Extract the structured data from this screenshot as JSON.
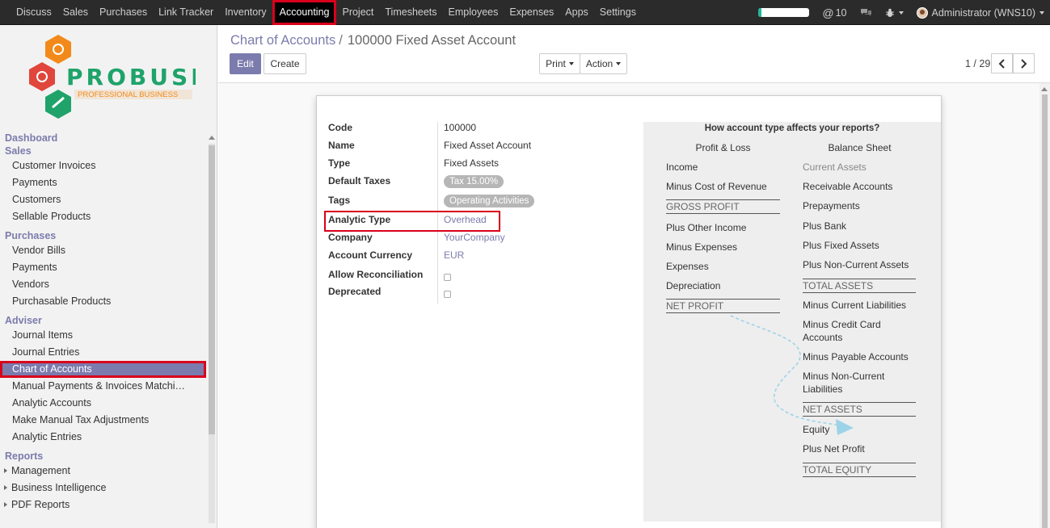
{
  "topbar": {
    "menu": [
      "Discuss",
      "Sales",
      "Purchases",
      "Link Tracker",
      "Inventory",
      "Accounting",
      "Project",
      "Timesheets",
      "Employees",
      "Expenses",
      "Apps",
      "Settings"
    ],
    "active_menu": "Accounting",
    "progress_fraction": 0.06,
    "activity_count": "10",
    "user": "Administrator (WNS10)"
  },
  "logo": {
    "name": "PROBUSE",
    "tagline": "PROFESSIONAL BUSINESS"
  },
  "sidebar": {
    "sections": [
      {
        "title": "Dashboard",
        "items": []
      },
      {
        "title": "Sales",
        "items": [
          "Customer Invoices",
          "Payments",
          "Customers",
          "Sellable Products"
        ]
      },
      {
        "title": "Purchases",
        "items": [
          "Vendor Bills",
          "Payments",
          "Vendors",
          "Purchasable Products"
        ]
      },
      {
        "title": "Adviser",
        "items": [
          "Journal Items",
          "Journal Entries",
          "Chart of Accounts",
          "Manual Payments & Invoices Matchi…",
          "Analytic Accounts",
          "Make Manual Tax Adjustments",
          "Analytic Entries"
        ]
      },
      {
        "title": "Reports",
        "items": [
          "Management",
          "Business Intelligence",
          "PDF Reports"
        ]
      }
    ],
    "active_item": "Chart of Accounts"
  },
  "control": {
    "breadcrumb_parent": "Chart of Accounts",
    "breadcrumb_sep": "/",
    "breadcrumb_current": "100000 Fixed Asset Account",
    "edit_label": "Edit",
    "create_label": "Create",
    "print_label": "Print",
    "action_label": "Action",
    "pager": "1 / 29"
  },
  "form": {
    "fields": [
      {
        "label": "Code",
        "value": "100000",
        "kind": "text"
      },
      {
        "label": "Name",
        "value": "Fixed Asset Account",
        "kind": "text"
      },
      {
        "label": "Type",
        "value": "Fixed Assets",
        "kind": "text"
      },
      {
        "label": "Default Taxes",
        "value": "Tax 15.00%",
        "kind": "badge"
      },
      {
        "label": "Tags",
        "value": "Operating Activities",
        "kind": "badge"
      },
      {
        "label": "Analytic Type",
        "value": "Overhead",
        "kind": "link"
      },
      {
        "label": "Company",
        "value": "YourCompany",
        "kind": "link"
      },
      {
        "label": "Account Currency",
        "value": "EUR",
        "kind": "link"
      },
      {
        "label": "Allow Reconciliation",
        "value": false,
        "kind": "checkbox"
      },
      {
        "label": "Deprecated",
        "value": false,
        "kind": "checkbox"
      }
    ]
  },
  "info": {
    "title": "How account type affects your reports?",
    "pl_header": "Profit & Loss",
    "bs_header": "Balance Sheet",
    "pl": [
      {
        "text": "Income",
        "style": "normal"
      },
      {
        "text": "Minus Cost of Revenue",
        "style": "normal"
      },
      {
        "text": "GROSS PROFIT",
        "style": "total"
      },
      {
        "text": "Plus Other Income",
        "style": "normal"
      },
      {
        "text": "Minus Expenses",
        "style": "normal"
      },
      {
        "text": "Expenses",
        "style": "normal"
      },
      {
        "text": "Depreciation",
        "style": "normal"
      },
      {
        "text": "NET PROFIT",
        "style": "total"
      }
    ],
    "bs": [
      {
        "text": "Current Assets",
        "style": "muted"
      },
      {
        "text": "Receivable Accounts",
        "style": "normal"
      },
      {
        "text": "Prepayments",
        "style": "normal"
      },
      {
        "text": "Plus Bank",
        "style": "normal"
      },
      {
        "text": "Plus Fixed Assets",
        "style": "normal"
      },
      {
        "text": "Plus Non-Current Assets",
        "style": "normal"
      },
      {
        "text": "TOTAL ASSETS",
        "style": "total"
      },
      {
        "text": "Minus Current Liabilities",
        "style": "normal"
      },
      {
        "text": "Minus Credit Card Accounts",
        "style": "wrap"
      },
      {
        "text": "Minus Payable Accounts",
        "style": "normal"
      },
      {
        "text": "Minus Non-Current Liabilities",
        "style": "wrap"
      },
      {
        "text": "NET ASSETS",
        "style": "total"
      },
      {
        "text": "Equity",
        "style": "normal"
      },
      {
        "text": "Plus Net Profit",
        "style": "normal"
      },
      {
        "text": "TOTAL EQUITY",
        "style": "total"
      }
    ]
  }
}
